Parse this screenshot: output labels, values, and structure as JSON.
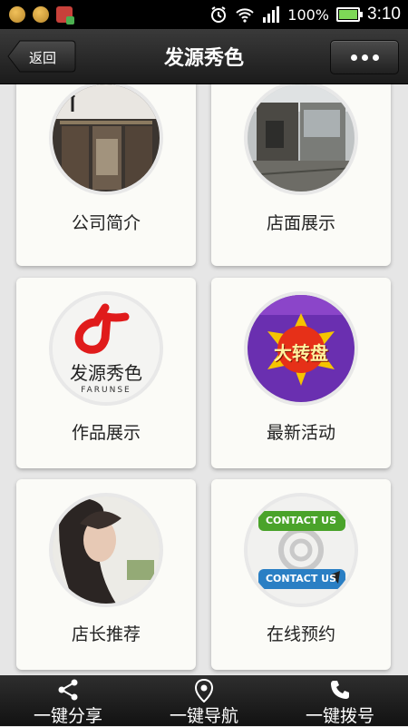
{
  "status_bar": {
    "battery": "100%",
    "time": "3:10"
  },
  "header": {
    "back_label": "返回",
    "title": "发源秀色"
  },
  "tiles": [
    {
      "label": "公司简介",
      "image": "storefront-photo"
    },
    {
      "label": "店面展示",
      "image": "shop-exterior-photo"
    },
    {
      "label": "作品展示",
      "image": "brand-logo"
    },
    {
      "label": "最新活动",
      "image": "lucky-wheel-graphic"
    },
    {
      "label": "店长推荐",
      "image": "model-portrait-photo"
    },
    {
      "label": "在线预约",
      "image": "contact-us-buttons"
    }
  ],
  "brand_logo": {
    "text": "发源秀色",
    "sub": "FARUNSE"
  },
  "lucky_wheel": {
    "text": "大转盘"
  },
  "contact_badges": [
    "CONTACT US",
    "CONTACT US"
  ],
  "bottom_bar": {
    "share": "一键分享",
    "navigate": "一键导航",
    "call": "一键拨号"
  },
  "colors": {
    "header": "#2a2a2a",
    "card": "#fbfbf7",
    "background": "#e6e6e6"
  }
}
